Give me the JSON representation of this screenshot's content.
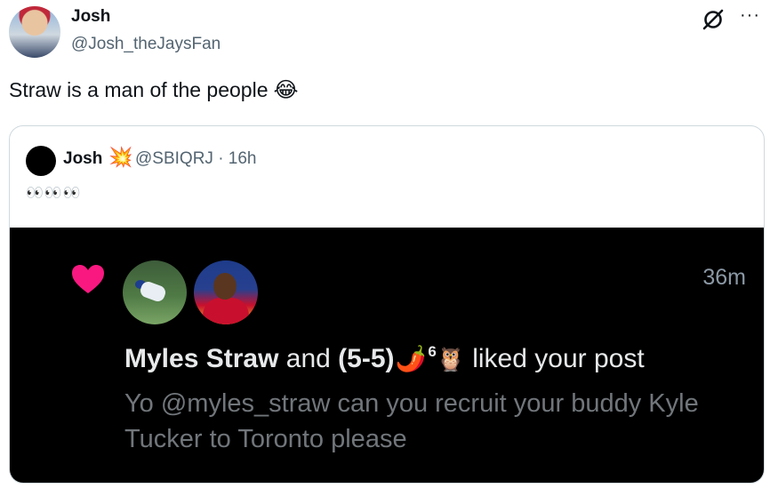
{
  "post": {
    "author_name": "Josh",
    "author_handle": "@Josh_theJaysFan",
    "text": "Straw is a man of the people",
    "text_emoji": "😂"
  },
  "actions": {
    "grok_icon": "grok-icon",
    "more_label": "···"
  },
  "quote": {
    "name": "Josh",
    "name_emoji": "💥",
    "handle_time": "@SBIQRJ · 16h",
    "body": "👀👀👀"
  },
  "embedded": {
    "time_ago": "36m",
    "liker_name": "Myles Straw",
    "connector": " and ",
    "other_name": "(5-5)",
    "chili": "🌶️",
    "superscript": "6",
    "owl": "🦉",
    "action_text": "liked your post",
    "post_text": "Yo @myles_straw can you recruit your buddy Kyle Tucker to Toronto please",
    "heart_color": "#f91880"
  }
}
